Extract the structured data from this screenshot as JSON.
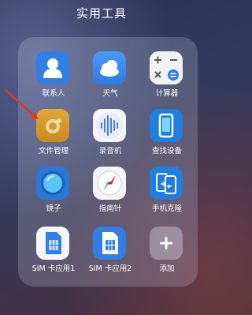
{
  "folder": {
    "title": "实用工具"
  },
  "apps": [
    {
      "label": "联系人",
      "icon": "contacts-icon"
    },
    {
      "label": "天气",
      "icon": "weather-icon"
    },
    {
      "label": "计算器",
      "icon": "calculator-icon"
    },
    {
      "label": "文件管理",
      "icon": "file-manager-icon"
    },
    {
      "label": "录音机",
      "icon": "recorder-icon"
    },
    {
      "label": "查找设备",
      "icon": "find-device-icon"
    },
    {
      "label": "镜子",
      "icon": "mirror-icon"
    },
    {
      "label": "指南针",
      "icon": "compass-icon"
    },
    {
      "label": "手机克隆",
      "icon": "phone-clone-icon"
    },
    {
      "label": "SIM 卡应用1",
      "icon": "sim-card-icon"
    },
    {
      "label": "SIM 卡应用2",
      "icon": "sim-card-icon"
    },
    {
      "label": "添加",
      "icon": "plus-icon"
    }
  ],
  "colors": {
    "accent_red": "#e8322e",
    "contacts": "#2f7fe6",
    "weather": "#3c8bf0",
    "file_manager": "#d99a2e",
    "find_device": "#1f7fe0",
    "phone_clone": "#1f7fe0"
  }
}
